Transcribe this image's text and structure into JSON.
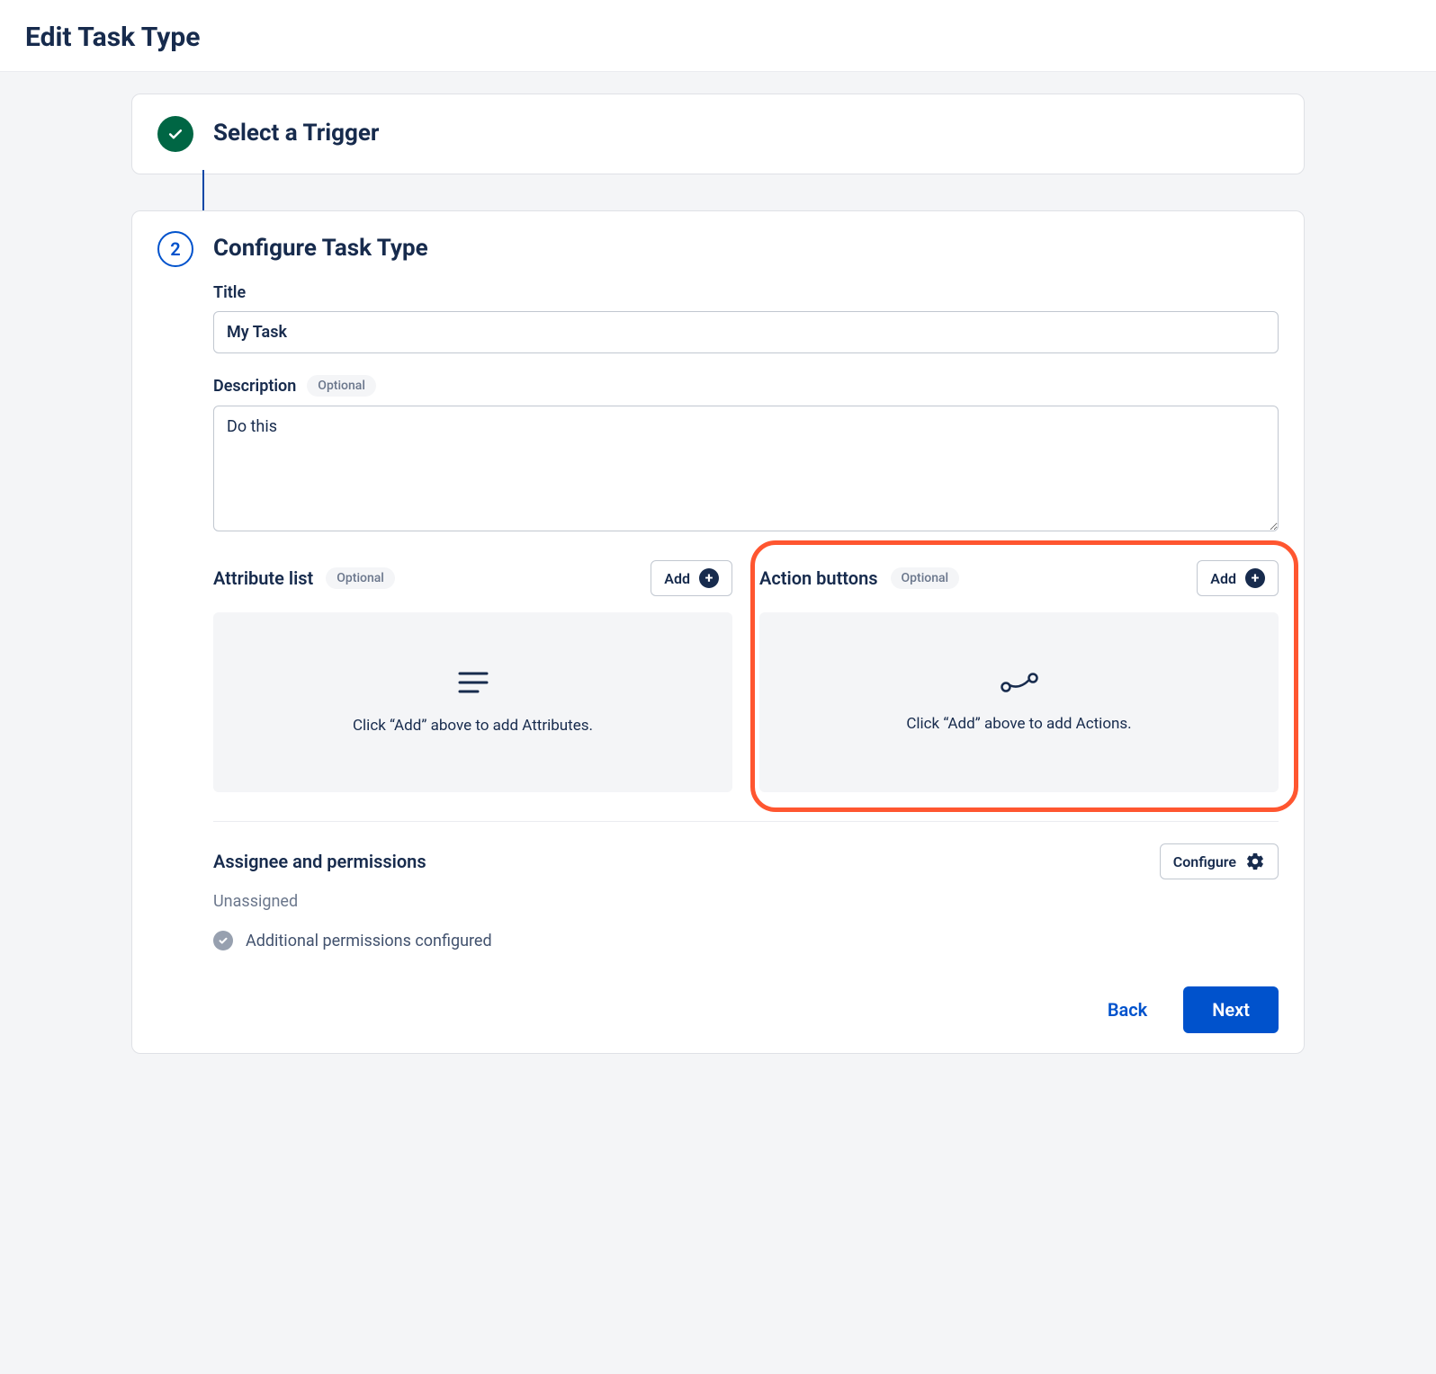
{
  "page": {
    "title": "Edit Task Type"
  },
  "steps": {
    "trigger": {
      "title": "Select a Trigger"
    },
    "configure": {
      "number": "2",
      "title": "Configure Task Type",
      "title_field": {
        "label": "Title",
        "value": "My Task"
      },
      "description_field": {
        "label": "Description",
        "optional": "Optional",
        "value": "Do this"
      },
      "attribute_list": {
        "title": "Attribute list",
        "optional": "Optional",
        "add_label": "Add",
        "empty_text": "Click “Add” above to add Attributes."
      },
      "action_buttons": {
        "title": "Action buttons",
        "optional": "Optional",
        "add_label": "Add",
        "empty_text": "Click “Add” above to add Actions."
      },
      "assignee": {
        "title": "Assignee and permissions",
        "configure_label": "Configure",
        "unassigned_text": "Unassigned",
        "permissions_text": "Additional permissions configured"
      },
      "footer": {
        "back_label": "Back",
        "next_label": "Next"
      }
    }
  }
}
